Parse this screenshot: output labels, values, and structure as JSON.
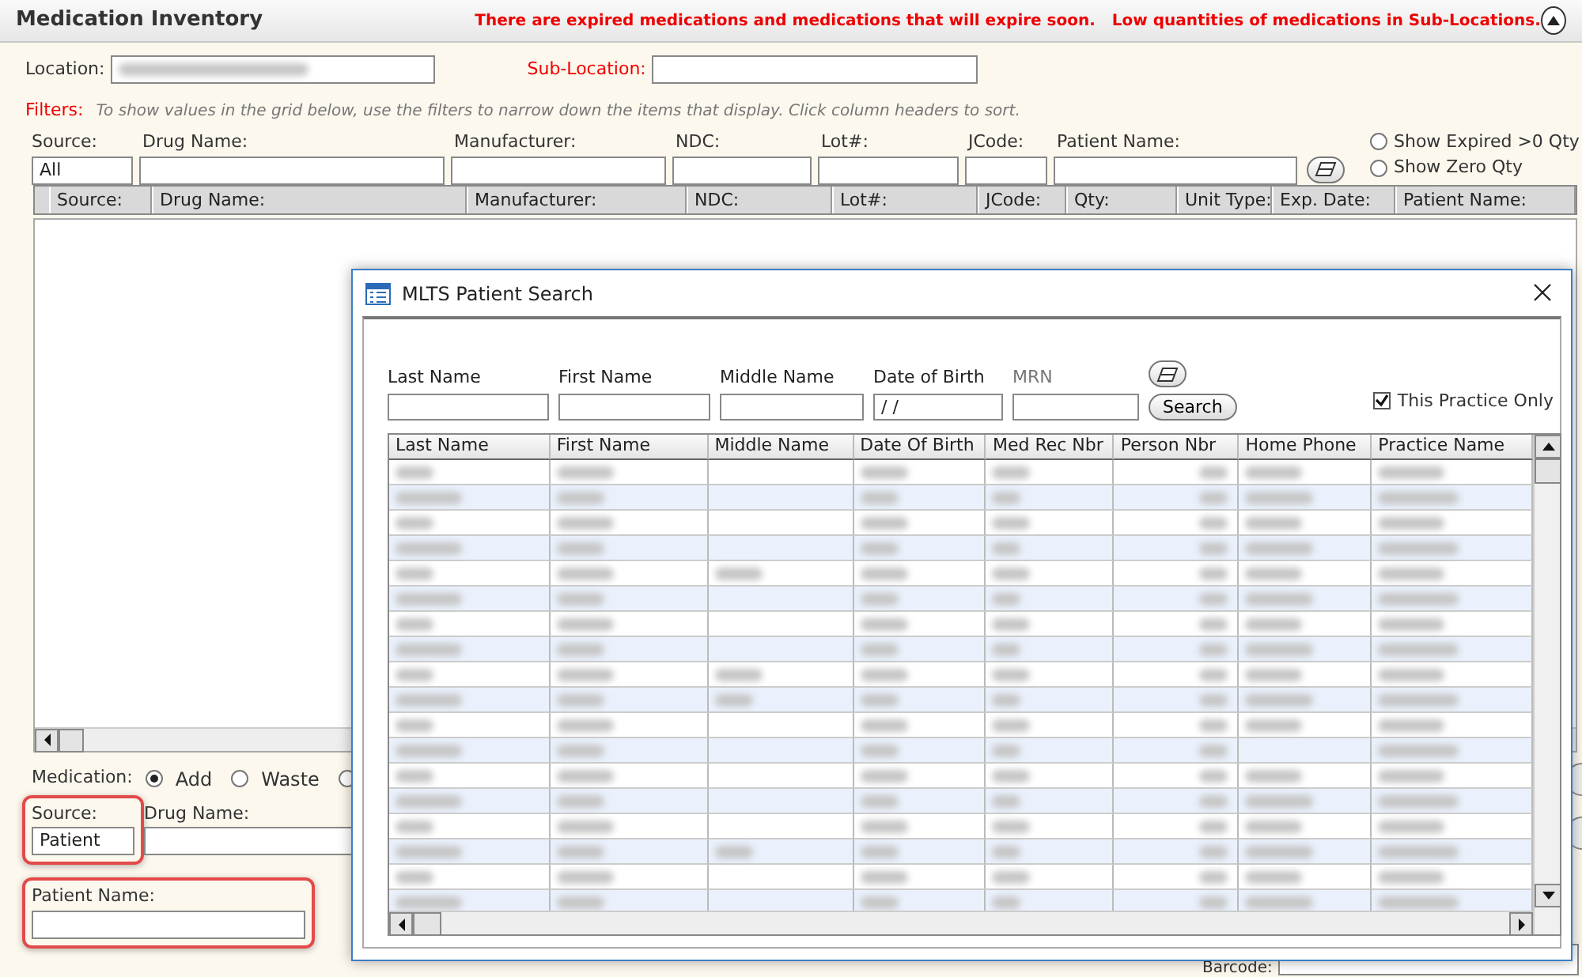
{
  "header": {
    "title": "Medication Inventory",
    "alert": "There are expired medications and medications that will expire soon.   Low quantities of medications in Sub-Locations.",
    "collapsed": false
  },
  "location": {
    "label": "Location:",
    "value_blurred": true
  },
  "sub_location": {
    "label": "Sub-Location:"
  },
  "filters": {
    "label": "Filters:",
    "hint": "To show values in the grid below, use the filters to narrow down the items that display. Click column headers to sort.",
    "fields": [
      {
        "label": "Source:",
        "value": "All"
      },
      {
        "label": "Drug Name:"
      },
      {
        "label": "Manufacturer:"
      },
      {
        "label": "NDC:"
      },
      {
        "label": "Lot#:"
      },
      {
        "label": "JCode:"
      },
      {
        "label": "Patient Name:"
      }
    ],
    "options": [
      {
        "label": "Show Expired >0 Qty",
        "selected": false
      },
      {
        "label": "Show Zero Qty",
        "selected": false
      }
    ]
  },
  "grid": {
    "columns": [
      "Source:",
      "Drug Name:",
      "Manufacturer:",
      "NDC:",
      "Lot#:",
      "JCode:",
      "Qty:",
      "Unit Type:",
      "Exp. Date:",
      "Patient Name:"
    ]
  },
  "medication": {
    "label": "Medication:",
    "actions": [
      {
        "label": "Add",
        "selected": true
      },
      {
        "label": "Waste",
        "selected": false
      },
      {
        "selected": false
      }
    ]
  },
  "source": {
    "label": "Source:",
    "value": "Patient",
    "highlighted": true
  },
  "drug_name": {
    "label": "Drug Name:"
  },
  "patient_name": {
    "label": "Patient Name:",
    "highlighted": true
  },
  "barcode": {
    "label": "Barcode:"
  },
  "dialog": {
    "title": "MLTS Patient Search",
    "fields": [
      {
        "label": "Last Name",
        "disabled": false
      },
      {
        "label": "First Name",
        "disabled": false
      },
      {
        "label": "Middle Name",
        "disabled": false
      },
      {
        "label": "Date of Birth",
        "value": " / /",
        "disabled": false
      },
      {
        "label": "MRN",
        "disabled": true
      }
    ],
    "search_button": "Search",
    "practice_only": {
      "label": "This Practice Only",
      "checked": true
    },
    "columns": [
      "Last Name",
      "First Name",
      "Middle Name",
      "Date Of Birth",
      "Med Rec Nbr",
      "Person Nbr",
      "Home Phone",
      "Practice Name"
    ],
    "blurred_rows": [
      {
        "striped": false,
        "middle_name_shown": false,
        "home_phone_shown": true
      },
      {
        "striped": true,
        "middle_name_shown": false,
        "home_phone_shown": true
      },
      {
        "striped": false,
        "middle_name_shown": false,
        "home_phone_shown": true
      },
      {
        "striped": true,
        "middle_name_shown": false,
        "home_phone_shown": true
      },
      {
        "striped": false,
        "middle_name_shown": true,
        "home_phone_shown": true
      },
      {
        "striped": true,
        "middle_name_shown": false,
        "home_phone_shown": true
      },
      {
        "striped": false,
        "middle_name_shown": false,
        "home_phone_shown": true
      },
      {
        "striped": true,
        "middle_name_shown": false,
        "home_phone_shown": true
      },
      {
        "striped": false,
        "middle_name_shown": true,
        "home_phone_shown": true
      },
      {
        "striped": true,
        "middle_name_shown": true,
        "home_phone_shown": true
      },
      {
        "striped": false,
        "middle_name_shown": false,
        "home_phone_shown": true
      },
      {
        "striped": true,
        "middle_name_shown": false,
        "home_phone_shown": false
      },
      {
        "striped": false,
        "middle_name_shown": false,
        "home_phone_shown": true
      },
      {
        "striped": true,
        "middle_name_shown": false,
        "home_phone_shown": true
      },
      {
        "striped": false,
        "middle_name_shown": false,
        "home_phone_shown": true
      },
      {
        "striped": true,
        "middle_name_shown": true,
        "home_phone_shown": true
      },
      {
        "striped": false,
        "middle_name_shown": false,
        "home_phone_shown": true
      },
      {
        "striped": true,
        "middle_name_shown": false,
        "home_phone_shown": true
      }
    ]
  }
}
